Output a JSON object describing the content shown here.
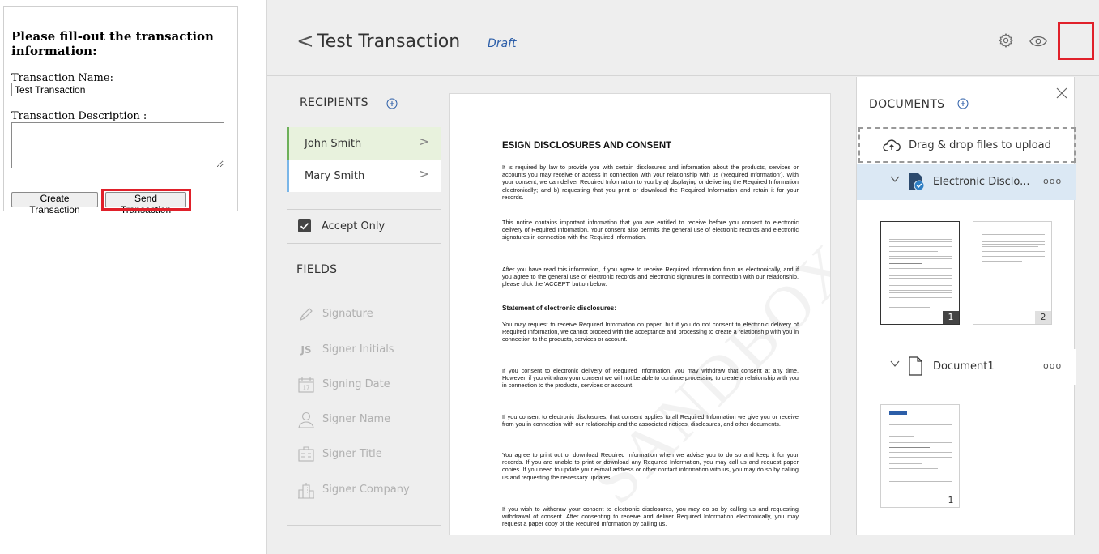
{
  "form": {
    "title": "Please fill-out the transaction information:",
    "name_label": "Transaction Name:",
    "name_value": "Test Transaction",
    "description_label": "Transaction Description :",
    "description_value": "",
    "create_label": "Create Transaction",
    "send_label": "Send Transaction"
  },
  "header": {
    "back_glyph": "<",
    "title": "Test Transaction",
    "status": "Draft"
  },
  "recipients": {
    "title": "RECIPIENTS",
    "items": [
      {
        "name": "John Smith",
        "chevron": ">"
      },
      {
        "name": "Mary Smith",
        "chevron": ">"
      }
    ]
  },
  "options": {
    "accept_only_label": "Accept Only",
    "accept_only_checked": true
  },
  "fields": {
    "title": "FIELDS",
    "items": [
      {
        "label": "Signature",
        "icon": "pen-icon"
      },
      {
        "label": "Signer Initials",
        "icon": "initials-icon",
        "glyph": "JS"
      },
      {
        "label": "Signing Date",
        "icon": "calendar-icon",
        "glyph": "17"
      },
      {
        "label": "Signer Name",
        "icon": "person-icon"
      },
      {
        "label": "Signer Title",
        "icon": "id-card-icon"
      },
      {
        "label": "Signer Company",
        "icon": "building-icon"
      }
    ]
  },
  "document": {
    "heading": "ESIGN DISCLOSURES AND CONSENT",
    "paragraphs": [
      "It is required by law to provide you with certain disclosures and information about the products, services or accounts you may receive or access in connection with your relationship with us ('Required Information'). With your consent, we can deliver Required Information to you by a) displaying or delivering the Required Information electronically; and b) requesting that you print or download the Required Information and retain it for your records.",
      "This notice contains important information that you are entitled to receive before you consent to electronic delivery of Required Information. Your consent also permits the general use of electronic records and electronic signatures in connection with the Required Information.",
      "After you have read this information, if you agree to receive Required Information from us electronically, and if you agree to the general use of electronic records and electronic signatures in connection with our relationship, please click the 'ACCEPT' button below."
    ],
    "subheading": "Statement of electronic disclosures:",
    "paragraphs2": [
      "You may request to receive Required Information on paper, but if you do not consent to electronic delivery of Required Information, we cannot proceed with the acceptance and processing to create a relationship with you in connection to the products, services or account.",
      "If you consent to electronic delivery of Required Information, you may withdraw that consent at any time. However, if you withdraw your consent we will not be able to continue processing to create a relationship with you in connection to the products, services or account.",
      "If you consent to electronic disclosures, that consent applies to all Required Information we give you or receive from you in connection with our relationship and the associated notices, disclosures, and other documents.",
      "You agree to print out or download Required Information when we advise you to do so and keep it for your records. If you are unable to print or download any Required Information, you may call us and request paper copies. If you need to update your e-mail address or other contact information with us, you may do so by calling us and requesting the necessary updates.",
      "If you wish to withdraw your consent to electronic disclosures, you may do so by calling us and requesting withdrawal of consent. After consenting to receive and deliver Required Information electronically, you may request a paper copy of the Required Information by calling us."
    ]
  },
  "documents_panel": {
    "title": "DOCUMENTS",
    "upload_label": "Drag & drop files to upload",
    "docs": [
      {
        "name": "Electronic Disclo...",
        "more": "ooo",
        "pages": [
          "1",
          "2"
        ]
      },
      {
        "name": "Document1",
        "more": "ooo",
        "pages": [
          "1"
        ]
      }
    ]
  },
  "colors": {
    "accent_blue": "#2c5ea8",
    "highlight_red": "#e0202a",
    "active_recipient": "#6db05a",
    "second_recipient": "#7ab6e8",
    "selected_doc_row": "#dbe8f4"
  }
}
